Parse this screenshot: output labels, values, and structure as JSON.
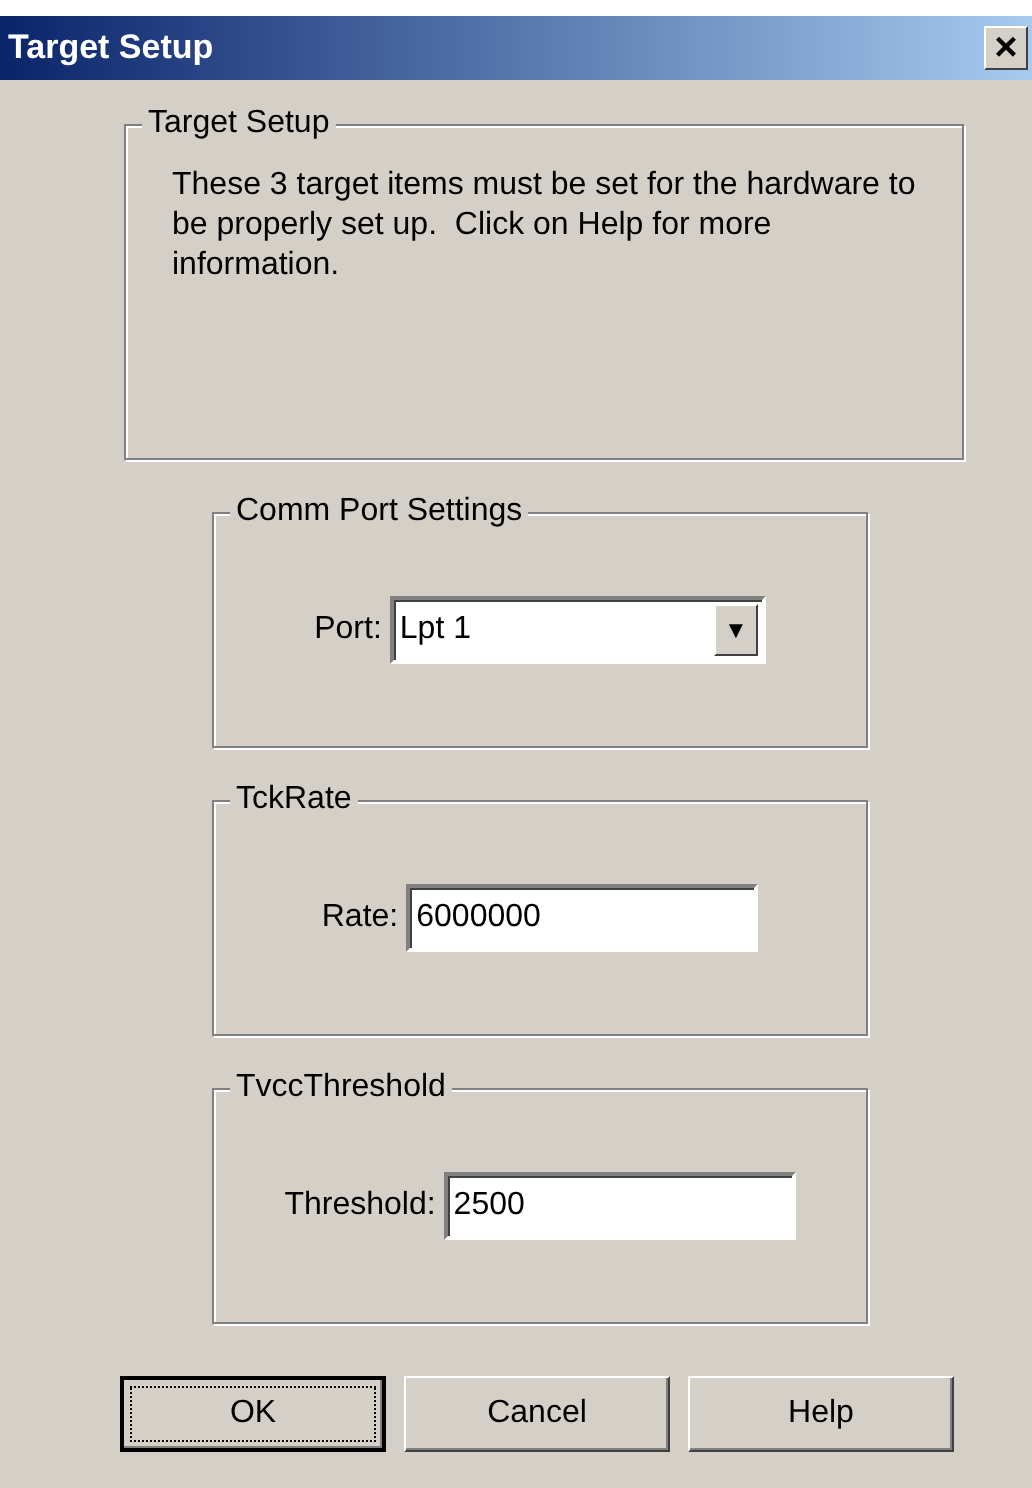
{
  "window": {
    "title": "Target Setup",
    "close": "×"
  },
  "intro_group": {
    "legend": "Target Setup",
    "text": "These 3 target items must be set for the hardware to be properly set up.  Click on Help for more information."
  },
  "groups": [
    {
      "legend": "Comm Port Settings",
      "label": "Port:",
      "kind": "dropdown",
      "value": "Lpt 1",
      "arrow": "▼"
    },
    {
      "legend": "TckRate",
      "label": "Rate:",
      "kind": "input",
      "value": "6000000"
    },
    {
      "legend": "TvccThreshold",
      "label": "Threshold:",
      "kind": "input",
      "value": "2500"
    }
  ],
  "buttons": [
    {
      "label": "OK",
      "focused": true
    },
    {
      "label": "Cancel",
      "focused": false
    },
    {
      "label": "Help",
      "focused": false
    }
  ]
}
